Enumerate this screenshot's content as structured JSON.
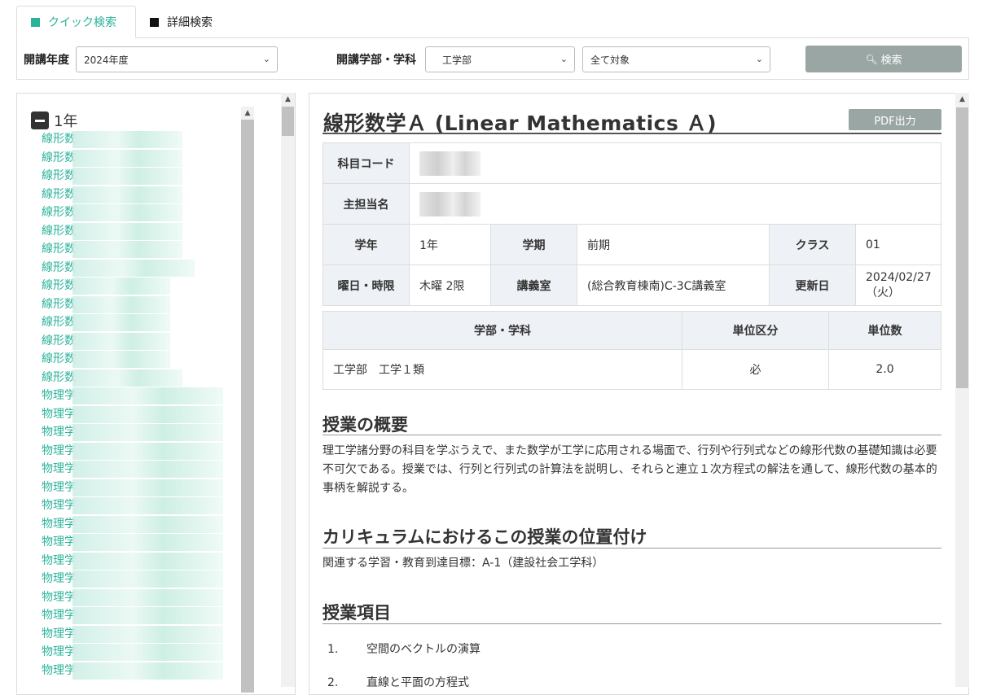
{
  "tabs": [
    {
      "label": "クイック検索"
    },
    {
      "label": "詳細検索"
    }
  ],
  "search": {
    "year_label": "開講年度",
    "year_value": "2024年度",
    "dept_label": "開講学部・学科",
    "dept_value": "工学部",
    "target_value": "全て対象",
    "search_button": "検索"
  },
  "tree": {
    "year_heading": "1年",
    "items": [
      "線形数",
      "線形数",
      "線形数",
      "線形数",
      "線形数",
      "線形数",
      "線形数",
      "線形数",
      "線形数",
      "線形数",
      "線形数",
      "線形数",
      "線形数",
      "線形数",
      "物理学",
      "物理学",
      "物理学",
      "物理学",
      "物理学",
      "物理学",
      "物理学",
      "物理学",
      "物理学",
      "物理学",
      "物理学",
      "物理学",
      "物理学",
      "物理学",
      "物理学",
      "物理学"
    ]
  },
  "course": {
    "title": "線形数学Ａ (Linear Mathematics Ａ)",
    "pdf_button": "PDF出力",
    "labels": {
      "code": "科目コード",
      "instructor": "主担当名",
      "grade": "学年",
      "term": "学期",
      "class": "クラス",
      "day_period": "曜日・時限",
      "room": "講義室",
      "updated": "更新日"
    },
    "grade": "1年",
    "term": "前期",
    "class": "01",
    "day_period": "木曜 2限",
    "room": "(総合教育棟南)C-3C講義室",
    "updated": "2024/02/27（火）",
    "credit_table": {
      "headers": [
        "学部・学科",
        "単位区分",
        "単位数"
      ],
      "row": [
        "工学部　工学１類",
        "必",
        "2.0"
      ]
    },
    "sections": {
      "overview_title": "授業の概要",
      "overview_text": "理工学諸分野の科目を学ぶうえで、また数学が工学に応用される場面で、行列や行列式などの線形代数の基礎知識は必要不可欠である。授業では、行列と行列式の計算法を説明し、それらと連立１次方程式の解法を通して、線形代数の基本的事柄を解説する。",
      "position_title": "カリキュラムにおけるこの授業の位置付け",
      "position_text": "関連する学習・教育到達目標：A-1（建設社会工学科）",
      "items_title": "授業項目",
      "items": [
        {
          "num": "1.",
          "text": "空間のベクトルの演算"
        },
        {
          "num": "2.",
          "text": "直線と平面の方程式"
        }
      ]
    }
  }
}
